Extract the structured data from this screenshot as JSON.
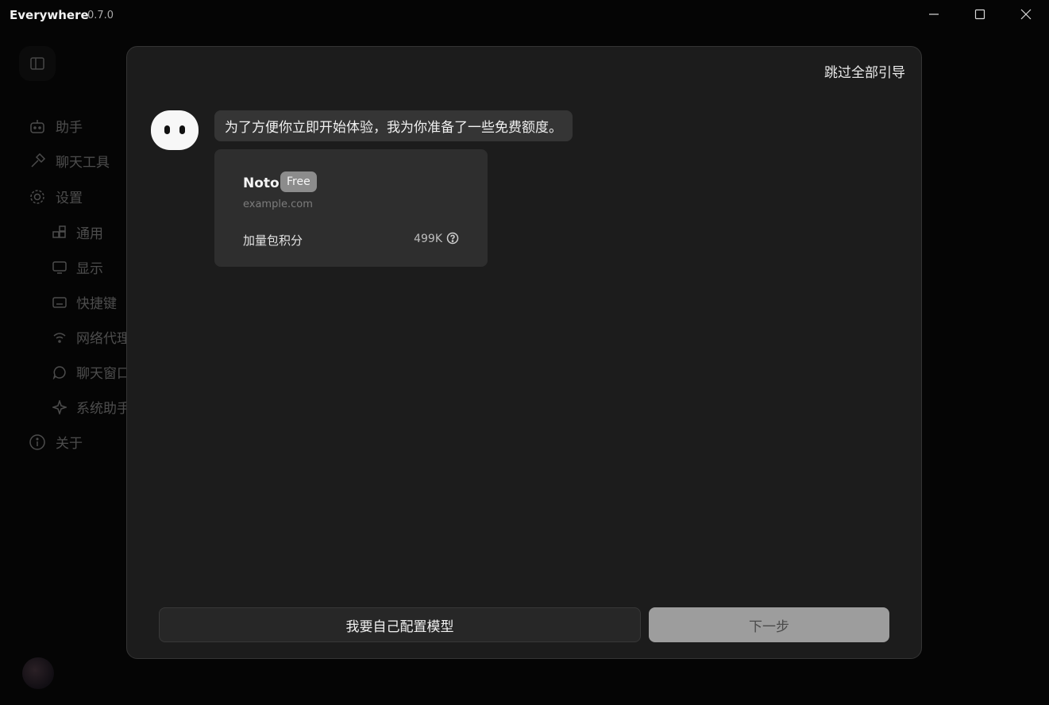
{
  "titlebar": {
    "app_name": "Everywhere",
    "version": "0.7.0"
  },
  "sidebar": {
    "items": [
      {
        "label": "助手",
        "icon": "robot-icon"
      },
      {
        "label": "聊天工具",
        "icon": "hammer-icon"
      },
      {
        "label": "设置",
        "icon": "gear-icon"
      },
      {
        "label": "通用",
        "icon": "apps-icon"
      },
      {
        "label": "显示",
        "icon": "monitor-icon"
      },
      {
        "label": "快捷键",
        "icon": "keyboard-icon"
      },
      {
        "label": "网络代理",
        "icon": "wifi-icon"
      },
      {
        "label": "聊天窗口",
        "icon": "chat-icon"
      },
      {
        "label": "系统助手",
        "icon": "sparkle-icon"
      },
      {
        "label": "关于",
        "icon": "info-icon"
      }
    ]
  },
  "modal": {
    "skip_label": "跳过全部引导",
    "message": "为了方便你立即开始体验，我为你准备了一些免费额度。",
    "card": {
      "name": "Noto",
      "badge": "Free",
      "domain": "example.com",
      "credit_label": "加量包积分",
      "credit_value": "499K"
    },
    "config_button_label": "我要自己配置模型",
    "next_button_label": "下一步"
  }
}
